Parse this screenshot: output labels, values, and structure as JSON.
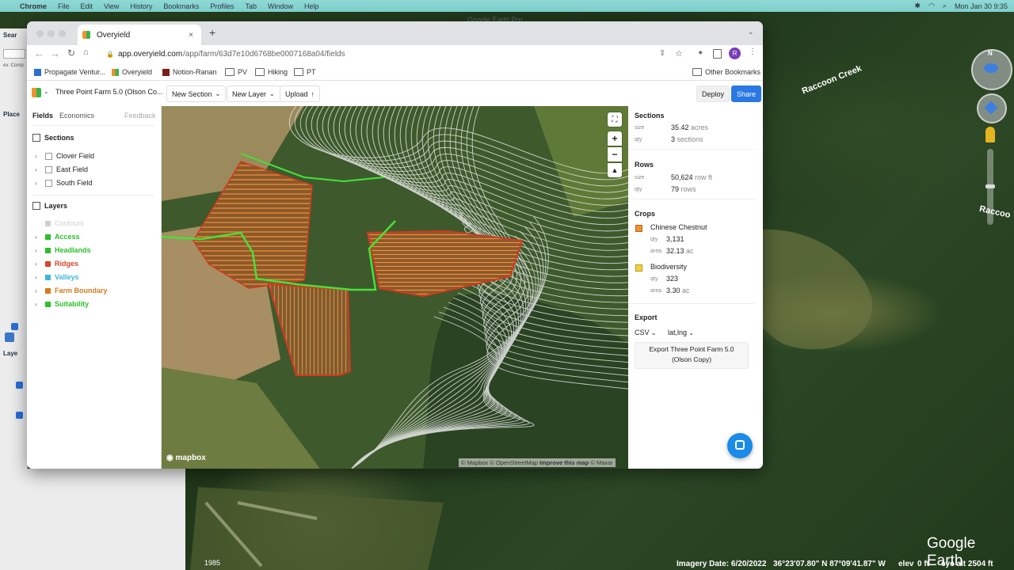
{
  "menubar": {
    "app": "Chrome",
    "items": [
      "File",
      "Edit",
      "View",
      "History",
      "Bookmarks",
      "Profiles",
      "Tab",
      "Window",
      "Help"
    ],
    "clock": "Mon Jan 30  9:35"
  },
  "google_earth": {
    "title": "Google Earth Pro",
    "creek_label_1": "Raccoon Creek",
    "creek_label_2": "Raccoo",
    "year": "1985",
    "imagery_date": "Imagery Date: 6/20/2022",
    "coords": "36°23'07.80\" N   87°09'41.87\" W",
    "elev_label": "elev",
    "elev_value": "0 ft",
    "eye_alt": "eye alt  2504 ft",
    "logo": "Google Earth",
    "search_label": "Sear",
    "places_label": "Place",
    "layers_label": "Laye",
    "ex_hint": "ex: Comp"
  },
  "browser": {
    "tab_title": "Overyield",
    "url_domain": "app.overyield.com",
    "url_path": "/app/farm/63d7e10d6768be0007168a04/fields",
    "avatar_letter": "R",
    "bookmarks": [
      "Propagate Ventur...",
      "Overyield",
      "Notion-Ranan",
      "PV",
      "Hiking",
      "PT"
    ],
    "other_bookmarks": "Other Bookmarks"
  },
  "app": {
    "farm_name": "Three Point Farm 5.0 (Olson Co...",
    "new_section": "New Section",
    "new_layer": "New Layer",
    "upload": "Upload",
    "deploy": "Deploy",
    "share": "Share",
    "tabs": {
      "fields": "Fields",
      "economics": "Economics",
      "feedback": "Feedback"
    },
    "sections_heading": "Sections",
    "sections": [
      "Clover Field",
      "East Field",
      "South Field"
    ],
    "layers_heading": "Layers",
    "layers": [
      {
        "label": "Contours",
        "color": "#cfcfcf"
      },
      {
        "label": "Access",
        "color": "#2bbf2b"
      },
      {
        "label": "Headlands",
        "color": "#2bbf2b"
      },
      {
        "label": "Ridges",
        "color": "#d9452b"
      },
      {
        "label": "Valleys",
        "color": "#3fb6d9"
      },
      {
        "label": "Farm Boundary",
        "color": "#d77a1c"
      },
      {
        "label": "Suitability",
        "color": "#2bbf2b"
      }
    ],
    "mapbox_logo": "mapbox",
    "attribution": {
      "mapbox": "© Mapbox",
      "osm": "© OpenStreetMap",
      "improve": "Improve this map",
      "maxar": "© Maxar"
    },
    "right": {
      "sections": {
        "heading": "Sections",
        "size_label": "size",
        "size_value": "35.42",
        "size_unit": "acres",
        "qty_label": "qty",
        "qty_value": "3",
        "qty_unit": "sections"
      },
      "rows": {
        "heading": "Rows",
        "size_label": "size",
        "size_value": "50,624",
        "size_unit": "row ft",
        "qty_label": "qty",
        "qty_value": "79",
        "qty_unit": "rows"
      },
      "crops": {
        "heading": "Crops",
        "items": [
          {
            "name": "Chinese Chestnut",
            "color": "#f0922f",
            "qty_label": "qty",
            "qty": "3,131",
            "area_label": "area",
            "area": "32.13",
            "area_unit": "ac"
          },
          {
            "name": "Biodiversity",
            "color": "#f5d23a",
            "qty_label": "qty",
            "qty": "323",
            "area_label": "area",
            "area": "3.30",
            "area_unit": "ac"
          }
        ]
      },
      "export": {
        "heading": "Export",
        "format": "CSV",
        "coords": "lat,lng",
        "button_line1": "Export Three Point Farm 5.0",
        "button_line2": "(Olson Copy)"
      }
    }
  }
}
